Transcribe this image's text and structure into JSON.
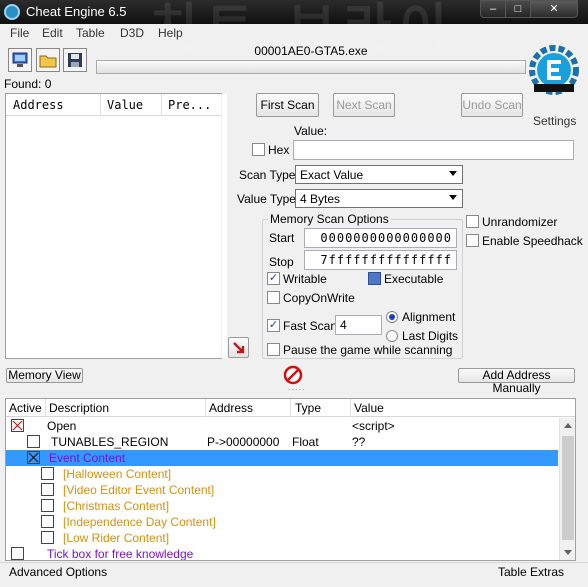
{
  "window": {
    "title": "Cheat Engine 6.5"
  },
  "menu": [
    "File",
    "Edit",
    "Table",
    "D3D",
    "Help"
  ],
  "toolbar": {
    "process_name": "00001AE0-GTA5.exe"
  },
  "found": {
    "label": "Found: 0"
  },
  "found_list": {
    "columns": [
      "Address",
      "Value",
      "Pre..."
    ]
  },
  "scan": {
    "first_scan": "First Scan",
    "next_scan": "Next Scan",
    "undo_scan": "Undo Scan",
    "settings": "Settings",
    "value_label": "Value:",
    "hex_label": "Hex",
    "scan_type_label": "Scan Type",
    "scan_type_value": "Exact Value",
    "value_type_label": "Value Type",
    "value_type_value": "4 Bytes"
  },
  "memory_scan_options": {
    "title": "Memory Scan Options",
    "start_label": "Start",
    "start_value": "0000000000000000",
    "stop_label": "Stop",
    "stop_value": "7fffffffffffffff",
    "writable": "Writable",
    "executable": "Executable",
    "copy_on_write": "CopyOnWrite",
    "fast_scan": "Fast Scan",
    "fast_scan_value": "4",
    "alignment": "Alignment",
    "last_digits": "Last Digits",
    "pause_game": "Pause the game while scanning"
  },
  "options": {
    "unrandomizer": "Unrandomizer",
    "enable_speedhack": "Enable Speedhack"
  },
  "buttons": {
    "memory_view": "Memory View",
    "add_address_manually": "Add Address Manually"
  },
  "address_list": {
    "columns": [
      "Active",
      "Description",
      "Address",
      "Type",
      "Value"
    ],
    "rows": [
      {
        "description": "Open",
        "address": "",
        "type": "",
        "value": "<script>",
        "color": "#000000"
      },
      {
        "description": "TUNABLES_REGION",
        "address": "P->00000000",
        "type": "Float",
        "value": "??",
        "color": "#000000"
      },
      {
        "description": "Event Content",
        "address": "",
        "type": "",
        "value": "",
        "color": "#7b0fd6"
      },
      {
        "description": "[Halloween Content]",
        "address": "",
        "type": "",
        "value": "",
        "color": "#d6900f"
      },
      {
        "description": "[Video Editor Event Content]",
        "address": "",
        "type": "",
        "value": "",
        "color": "#d6900f"
      },
      {
        "description": "[Christmas Content]",
        "address": "",
        "type": "",
        "value": "",
        "color": "#d6900f"
      },
      {
        "description": "[Independence Day Content]",
        "address": "",
        "type": "",
        "value": "",
        "color": "#d6900f"
      },
      {
        "description": "[Low Rider Content]",
        "address": "",
        "type": "",
        "value": "",
        "color": "#d6900f"
      },
      {
        "description": "Tick box for free knowledge",
        "address": "",
        "type": "",
        "value": "",
        "color": "#7b0fd6"
      }
    ]
  },
  "footer": {
    "advanced_options": "Advanced Options",
    "table_extras": "Table Extras"
  }
}
